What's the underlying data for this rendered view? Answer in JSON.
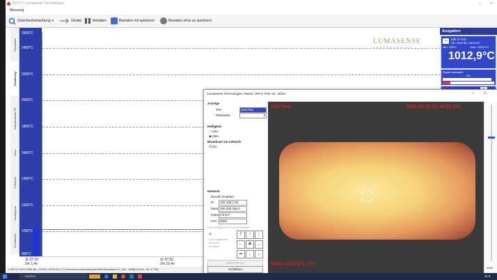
{
  "titlebar": {
    "temp": "1012°C",
    "app": "Lumasense Technologies",
    "minimize": "–",
    "restore": "□"
  },
  "menu": {
    "item": "Messung"
  },
  "toolbar": {
    "zoom_label": "Zwischenbetrachtung",
    "devices_label": "Geräte",
    "pause_label": "Anhalten",
    "save_exit_label": "Beenden mit speichern",
    "exit_nosave_label": "Beenden ohne zu speichern"
  },
  "vtabs": [
    "Parameter",
    "Skalierung",
    "Aufnahmeliste PC",
    "Zone",
    "Sollwerte",
    "Analog Aus.",
    "IO-Interface"
  ],
  "chart_data": {
    "type": "line",
    "ylabel": "",
    "yticks": [
      "2500°C",
      "2400°C",
      "2200°C",
      "2000°C",
      "1800°C",
      "1600°C",
      "1400°C",
      "1200°C",
      "1000°C",
      "800°C"
    ],
    "ylim": [
      800,
      2500
    ],
    "xticks": [
      {
        "time": "11:37:16",
        "span": "2m 1,4s"
      },
      {
        "time": "11:37:32",
        "span": "2m 15,4s"
      }
    ],
    "series": [
      {
        "values": [
          1012.9,
          1012.9
        ]
      }
    ],
    "grid": true
  },
  "logo": {
    "name": "LUMASENSE",
    "sub": "TECHNOLOGIES"
  },
  "status": "1  ISR 6-TVD/COM6.86 | 19200 | 00:00.00 | C:\\Users\\udo.schomberg\\InfraWin\\Standard.i12 | [Nr.: 4868] [Größe: 52,37 KB]",
  "panel": {
    "header": "Ausgaben",
    "device": "ISR 6-TVD",
    "sn": "SN: 3022 BK: 3610152",
    "min": "Min: 706°C",
    "max": "Max: 1026,3°C",
    "value": "1012,9°C",
    "signal_label": "Signal-Intensität",
    "signal_value": "0%",
    "warn_label": "Warnschwelle",
    "warn_value": "0",
    "off_label": "Abschaltschwelle",
    "off_value": "15"
  },
  "dialog": {
    "title": "Lumasense Technologies  <Name: ISR 6-TVD, Nr.: 3022>",
    "min": "–",
    "max": "□",
    "anzeige": "Anzeige",
    "text_label": "Text",
    "text_value": "UserText",
    "param_label": "Parameter",
    "hell": "Helligkeit",
    "auto": "Auto.",
    "man": "Man.",
    "broadcast": "Broadcast via network",
    "ein": "Ein",
    "network": "Network",
    "dhcp": "DHCP",
    "enabled": "Enabled",
    "ip_label": "IP",
    "ip": "192.168.2.55",
    "mask_label": "Mask",
    "mask": "255.255.255.0",
    "gw_label": "Gateway",
    "gw": "0.0.0.0",
    "port_label": "Port",
    "port": "5000",
    "focus_hdr": "Auto Brightness Focus Region",
    "focus_note": "Auto brightness could be enabled",
    "ubernehmen": "Übernehmen",
    "schliessen": "Schließen",
    "cam_usertext": "UserText",
    "cam_timestamp": "2021-03-22 11:36:58.31s",
    "cam_reading": "Ratio-1012.9°C | ??",
    "scroll_value": "3000"
  },
  "taskbar": {
    "search": "Suchen",
    "clock": "11:3"
  }
}
